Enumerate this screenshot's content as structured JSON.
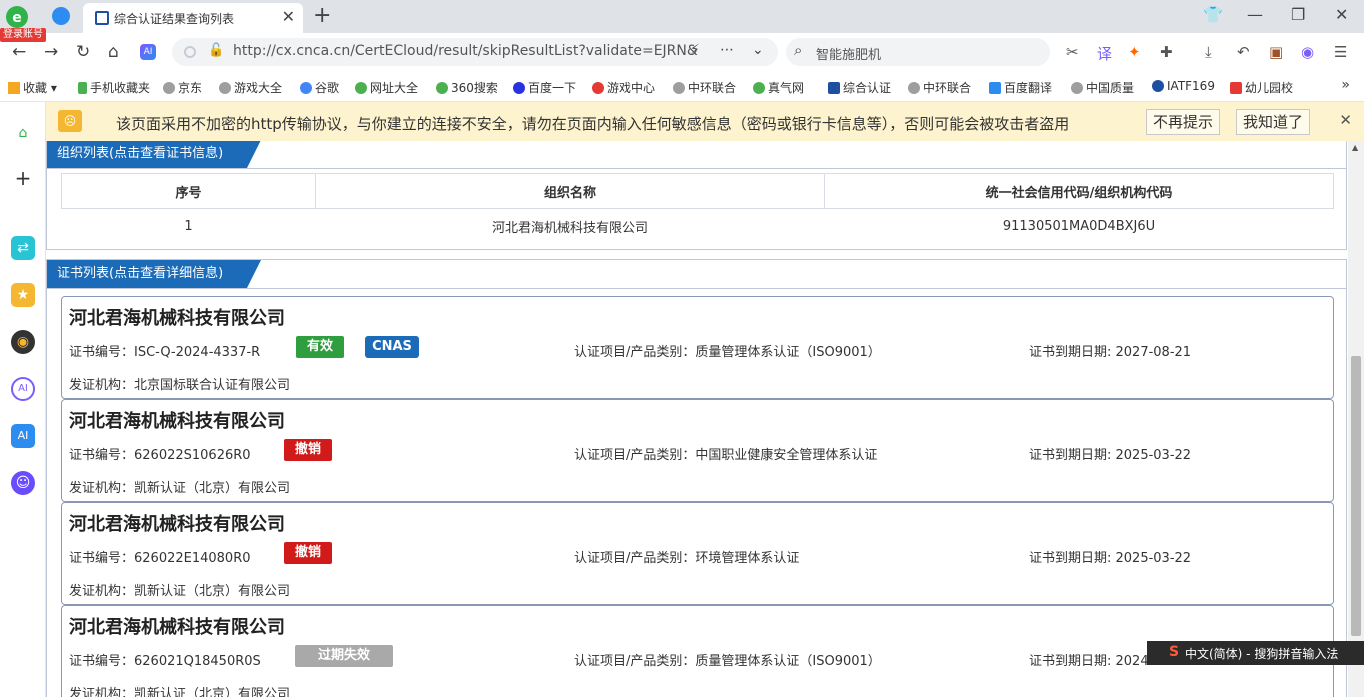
{
  "browser": {
    "login_badge": "登录账号",
    "tab_title": "综合认证结果查询列表",
    "url": "http://cx.cnca.cn/CertECloud/result/skipResultList?validate=EJRN&",
    "search_text": "智能施肥机",
    "ai_label": "AI"
  },
  "bookmarks": [
    {
      "label": "收藏",
      "color": "#f5a623"
    },
    {
      "label": "手机收藏夹",
      "color": "#4caf50"
    },
    {
      "label": "京东",
      "color": "#9e9e9e"
    },
    {
      "label": "游戏大全",
      "color": "#9e9e9e"
    },
    {
      "label": "谷歌",
      "color": "#4285f4"
    },
    {
      "label": "网址大全",
      "color": "#4caf50"
    },
    {
      "label": "360搜索",
      "color": "#4caf50"
    },
    {
      "label": "百度一下",
      "color": "#2932e1"
    },
    {
      "label": "游戏中心",
      "color": "#e53935"
    },
    {
      "label": "中环联合",
      "color": "#9e9e9e"
    },
    {
      "label": "真气网",
      "color": "#4caf50"
    },
    {
      "label": "综合认证",
      "color": "#1e4fa1"
    },
    {
      "label": "中环联合",
      "color": "#9e9e9e"
    },
    {
      "label": "百度翻译",
      "color": "#2d8cf0"
    },
    {
      "label": "中国质量",
      "color": "#9e9e9e"
    },
    {
      "label": "IATF169",
      "color": "#1e4fa1"
    },
    {
      "label": "幼儿园校",
      "color": "#e53935"
    }
  ],
  "warning": {
    "message": "该页面采用不加密的http传输协议，与你建立的连接不安全，请勿在页面内输入任何敏感信息（密码或银行卡信息等），否则可能会被攻击者盗用",
    "dismiss_label": "不再提示",
    "ok_label": "我知道了"
  },
  "org_panel": {
    "title": "组织列表(点击查看证书信息)",
    "headers": [
      "序号",
      "组织名称",
      "统一社会信用代码/组织机构代码"
    ],
    "rows": [
      {
        "index": "1",
        "name": "河北君海机械科技有限公司",
        "code": "91130501MA0D4BXJ6U"
      }
    ]
  },
  "cert_panel": {
    "title": "证书列表(点击查看详细信息)",
    "certs": [
      {
        "org": "河北君海机械科技有限公司",
        "cert_no": "证书编号：ISC-Q-2024-4337-R",
        "status": "有效",
        "status_color": "#2e9e3e",
        "extra_badge": "CNAS",
        "project": "认证项目/产品类别：质量管理体系认证（ISO9001）",
        "expiry": "证书到期日期: 2027-08-21",
        "issuer": "发证机构：北京国标联合认证有限公司"
      },
      {
        "org": "河北君海机械科技有限公司",
        "cert_no": "证书编号：626022S10626R0",
        "status": "撤销",
        "status_color": "#d11a1a",
        "project": "认证项目/产品类别：中国职业健康安全管理体系认证",
        "expiry": "证书到期日期: 2025-03-22",
        "issuer": "发证机构：凯新认证（北京）有限公司"
      },
      {
        "org": "河北君海机械科技有限公司",
        "cert_no": "证书编号：626022E14080R0",
        "status": "撤销",
        "status_color": "#d11a1a",
        "project": "认证项目/产品类别：环境管理体系认证",
        "expiry": "证书到期日期: 2025-03-22",
        "issuer": "发证机构：凯新认证（北京）有限公司"
      },
      {
        "org": "河北君海机械科技有限公司",
        "cert_no": "证书编号：626021Q18450R0S",
        "status": "过期失效",
        "status_color": "#a9a9a9",
        "project": "认证项目/产品类别：质量管理体系认证（ISO9001）",
        "expiry": "证书到期日期: 2024",
        "issuer": "发证机构：凯新认证（北京）有限公司"
      }
    ]
  },
  "ime": {
    "label": "中文(简体) - 搜狗拼音输入法"
  },
  "colors": {
    "accent": "#1c6bb8",
    "warning_bg": "#fdf3cf"
  }
}
